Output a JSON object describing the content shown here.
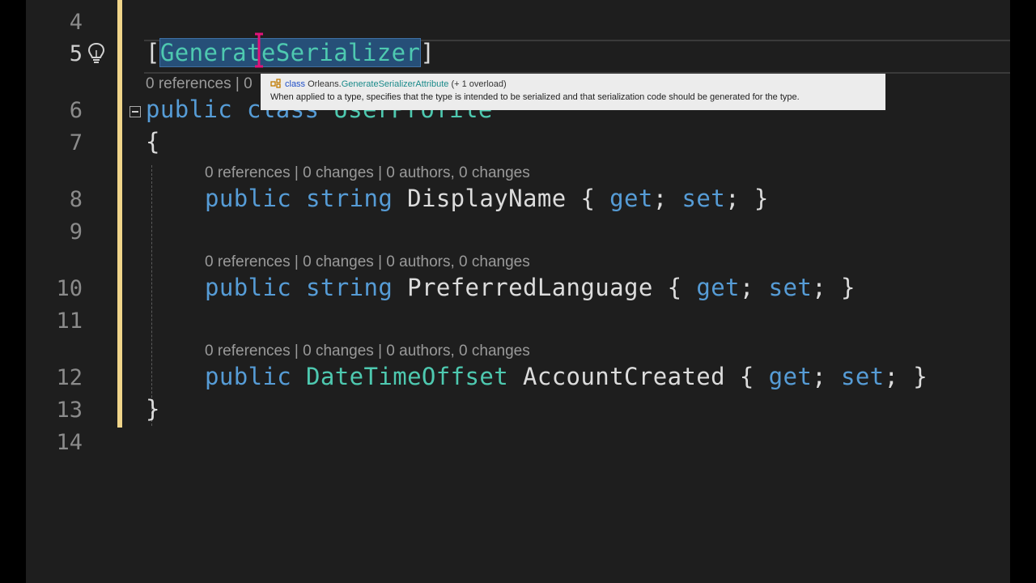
{
  "editor": {
    "lines": [
      {
        "num": "4"
      },
      {
        "num": "5"
      },
      {
        "num": "6"
      },
      {
        "num": "7"
      },
      {
        "num": "8"
      },
      {
        "num": "9"
      },
      {
        "num": "10"
      },
      {
        "num": "11"
      },
      {
        "num": "12"
      },
      {
        "num": "13"
      },
      {
        "num": "14"
      }
    ],
    "code": {
      "attr_open": "[",
      "attr_name": "GenerateSerializer",
      "attr_close": "]",
      "public": "public",
      "class_kw": "class",
      "class_name": "UserProfile",
      "brace_open": "{",
      "brace_close": "}",
      "string_kw": "string",
      "prop1_name": "DisplayName",
      "prop2_name": "PreferredLanguage",
      "prop3_type": "DateTimeOffset",
      "prop3_name": "AccountCreated",
      "accessors_open": "{ ",
      "get_kw": "get",
      "semi": "; ",
      "set_kw": "set",
      "accessors_close": "; }"
    },
    "codelens": {
      "class_lens": "0 references | 0",
      "prop_lens": "0 references | 0 changes | 0 authors, 0 changes"
    }
  },
  "tooltip": {
    "icon": "class-icon",
    "kind": "class",
    "namespace": "Orleans.",
    "type_name": "GenerateSerializerAttribute",
    "overload": "(+ 1 overload)",
    "description": "When applied to a type, specifies that the type is intended to be serialized and that serialization code should be generated for the type."
  },
  "colors": {
    "background": "#1e1e1e",
    "keyword": "#569cd6",
    "type": "#4ec9b0",
    "change_bar": "#f0d58a",
    "selection": "#264f78"
  }
}
